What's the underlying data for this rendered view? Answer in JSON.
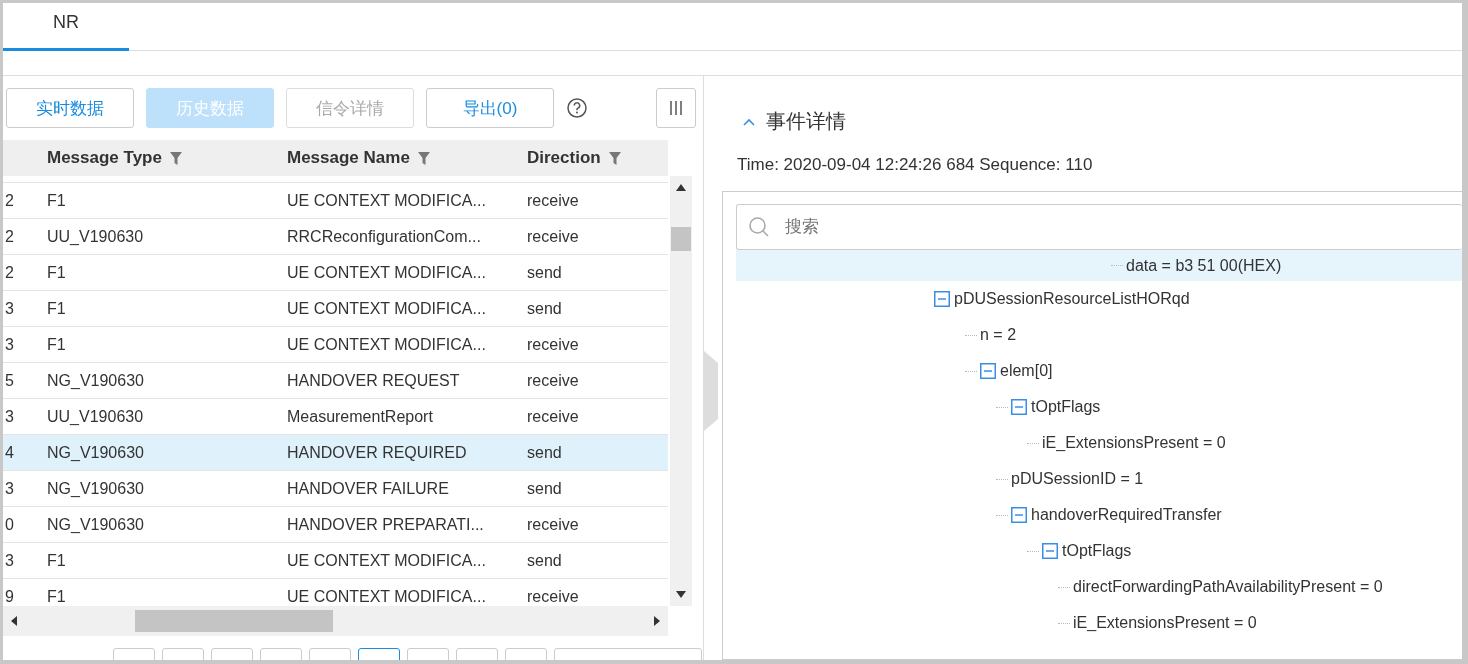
{
  "tabs": [
    {
      "label": "NR",
      "selected": true
    }
  ],
  "toolbar": {
    "buttons": [
      {
        "label": "实时数据",
        "kind": "outline"
      },
      {
        "label": "历史数据",
        "kind": "active"
      },
      {
        "label": "信令详情",
        "kind": "disabled"
      },
      {
        "label": "导出(0)",
        "kind": "outline"
      }
    ]
  },
  "table": {
    "columns": [
      "Message Type",
      "Message Name",
      "Direction"
    ],
    "rows": [
      {
        "column_1": "2",
        "type": "F1",
        "name": "UE CONTEXT MODIFICA...",
        "direction": "receive",
        "selected": false
      },
      {
        "column_1": "2",
        "type": "UU_V190630",
        "name": "RRCReconfigurationCom...",
        "direction": "receive",
        "selected": false
      },
      {
        "column_1": "2",
        "type": "F1",
        "name": "UE CONTEXT MODIFICA...",
        "direction": "send",
        "selected": false
      },
      {
        "column_1": "3",
        "type": "F1",
        "name": "UE CONTEXT MODIFICA...",
        "direction": "send",
        "selected": false
      },
      {
        "column_1": "3",
        "type": "F1",
        "name": "UE CONTEXT MODIFICA...",
        "direction": "receive",
        "selected": false
      },
      {
        "column_1": "5",
        "type": "NG_V190630",
        "name": "HANDOVER REQUEST",
        "direction": "receive",
        "selected": false
      },
      {
        "column_1": "3",
        "type": "UU_V190630",
        "name": "MeasurementReport",
        "direction": "receive",
        "selected": false
      },
      {
        "column_1": "4",
        "type": "NG_V190630",
        "name": "HANDOVER REQUIRED",
        "direction": "send",
        "selected": true
      },
      {
        "column_1": "3",
        "type": "NG_V190630",
        "name": "HANDOVER FAILURE",
        "direction": "send",
        "selected": false
      },
      {
        "column_1": "0",
        "type": "NG_V190630",
        "name": "HANDOVER PREPARATI...",
        "direction": "receive",
        "selected": false
      },
      {
        "column_1": "3",
        "type": "F1",
        "name": "UE CONTEXT MODIFICA...",
        "direction": "send",
        "selected": false
      },
      {
        "column_1": "9",
        "type": "F1",
        "name": "UE CONTEXT MODIFICA...",
        "direction": "receive",
        "selected": false
      }
    ]
  },
  "details": {
    "title": "事件详情",
    "expanded": true,
    "info": "Time: 2020-09-04 12:24:26 684 Sequence: 110",
    "search": {
      "placeholder": "搜索"
    },
    "top_line": {
      "label": "data = b3 51 00(HEX)",
      "selected": true
    },
    "tree": [
      {
        "label": "pDUSessionResourceListHORqd",
        "expanded": true,
        "children": [
          {
            "label": "n = 2"
          },
          {
            "label": "elem[0]",
            "expanded": true,
            "children": [
              {
                "label": "tOptFlags",
                "expanded": true,
                "children": [
                  {
                    "label": "iE_ExtensionsPresent = 0"
                  }
                ]
              },
              {
                "label": "pDUSessionID = 1"
              },
              {
                "label": "handoverRequiredTransfer",
                "expanded": true,
                "children": [
                  {
                    "label": "tOptFlags",
                    "expanded": true,
                    "children": [
                      {
                        "label": "directForwardingPathAvailabilityPresent = 0"
                      },
                      {
                        "label": "iE_ExtensionsPresent = 0"
                      }
                    ]
                  }
                ]
              }
            ]
          }
        ]
      }
    ]
  }
}
